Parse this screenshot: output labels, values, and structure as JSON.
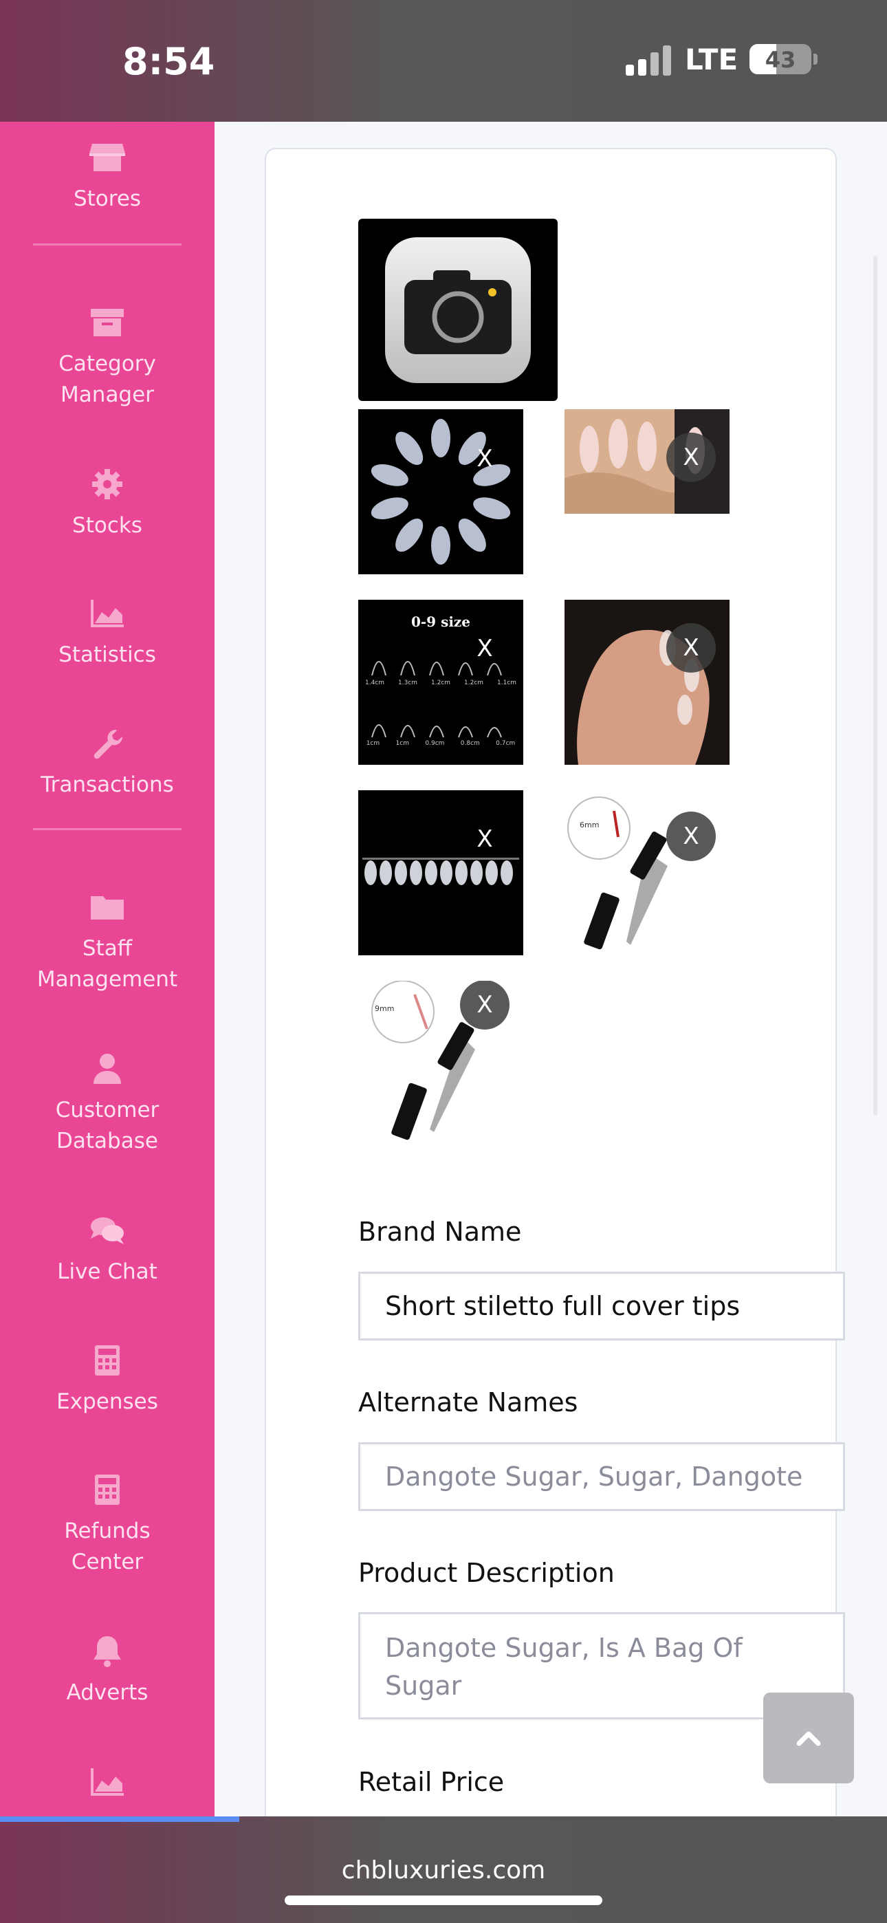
{
  "status_bar": {
    "time": "8:54",
    "network": "LTE",
    "battery": "43",
    "battery_level": 0.43
  },
  "sidebar": {
    "items": [
      {
        "label": "Stores",
        "icon": "store-icon"
      },
      {
        "label": "Category\nManager",
        "icon": "archive-icon"
      },
      {
        "label": "Stocks",
        "icon": "gear-icon"
      },
      {
        "label": "Statistics",
        "icon": "chart-area-icon"
      },
      {
        "label": "Transactions",
        "icon": "wrench-icon"
      },
      {
        "label": "Staff\nManagement",
        "icon": "folder-icon"
      },
      {
        "label": "Customer\nDatabase",
        "icon": "user-icon"
      },
      {
        "label": "Live Chat",
        "icon": "chat-icon"
      },
      {
        "label": "Expenses",
        "icon": "calculator-icon"
      },
      {
        "label": "Refunds\nCenter",
        "icon": "calculator-icon"
      },
      {
        "label": "Adverts",
        "icon": "bell-icon"
      }
    ]
  },
  "images": {
    "remove_label": "X",
    "thumbnails": [
      {
        "name": "nail-tips-circle"
      },
      {
        "name": "almond-nails-hand"
      },
      {
        "name": "nail-size-chart",
        "caption": "0-9 size",
        "sizes": [
          "1.4cm",
          "1.3cm",
          "1.2cm",
          "1.2cm",
          "1.1cm",
          "1cm",
          "1cm",
          "0.9cm",
          "0.8cm",
          "0.7cm"
        ]
      },
      {
        "name": "clear-nails-hand"
      },
      {
        "name": "nail-tips-row"
      },
      {
        "name": "nail-brush-6mm",
        "caption": "6mm"
      },
      {
        "name": "nail-brush-9mm",
        "caption": "9mm"
      }
    ]
  },
  "form": {
    "brand_label": "Brand Name",
    "brand_value": "Short stiletto full cover tips",
    "alt_label": "Alternate Names",
    "alt_placeholder": "Dangote Sugar, Sugar, Dangote",
    "desc_label": "Product Description",
    "desc_placeholder": "Dangote Sugar, Is A Bag Of Sugar",
    "price_label": "Retail Price"
  },
  "scroll_top_icon": "chevron-up-icon",
  "browser": {
    "url": "chbluxuries.com",
    "load_progress": 0.27
  },
  "colors": {
    "sidebar": "#e94695",
    "accent_progress": "#5b8cf5"
  }
}
